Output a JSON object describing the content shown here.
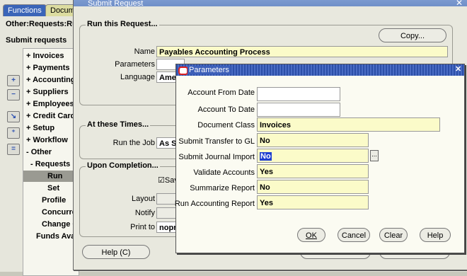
{
  "navigator": {
    "tabs": [
      "Functions",
      "Documents"
    ],
    "title": "Other:Requests:Run",
    "subtitle": "Submit requests",
    "items": [
      {
        "prefix": "+",
        "label": "Invoices"
      },
      {
        "prefix": "+",
        "label": "Payments"
      },
      {
        "prefix": "+",
        "label": "Accounting"
      },
      {
        "prefix": "+",
        "label": "Suppliers"
      },
      {
        "prefix": "+",
        "label": "Employees"
      },
      {
        "prefix": "+",
        "label": "Credit Card"
      },
      {
        "prefix": "+",
        "label": "Setup"
      },
      {
        "prefix": "+",
        "label": "Workflow"
      },
      {
        "prefix": "-",
        "label": "Other"
      },
      {
        "prefix": "-",
        "label": "Requests"
      },
      {
        "prefix": "",
        "label": "Run"
      },
      {
        "prefix": "",
        "label": "Set"
      },
      {
        "prefix": "",
        "label": "Profile"
      },
      {
        "prefix": "",
        "label": "Concurrent"
      },
      {
        "prefix": "",
        "label": "Change C"
      },
      {
        "prefix": "",
        "label": "Funds Available"
      }
    ]
  },
  "submit_request": {
    "title": "Submit Request",
    "run_group": "Run this Request...",
    "copy_button": "Copy...",
    "name_label": "Name",
    "name_value": "Payables Accounting Process",
    "parameters_label": "Parameters",
    "language_label": "Language",
    "language_value": "Ame",
    "times_group": "At these Times...",
    "run_job_label": "Run the Job",
    "run_job_value": "As So",
    "completion_group": "Upon Completion...",
    "save_label": "Sav",
    "layout_label": "Layout",
    "notify_label": "Notify",
    "print_to_label": "Print to",
    "print_to_value": "nopr",
    "help_button": "Help (C)"
  },
  "parameters": {
    "title": "Parameters",
    "fields": [
      {
        "label": "Account From Date",
        "value": ""
      },
      {
        "label": "Account To Date",
        "value": ""
      },
      {
        "label": "Document Class",
        "value": "Invoices"
      },
      {
        "label": "Submit Transfer to GL",
        "value": "No"
      },
      {
        "label": "Submit Journal Import",
        "value": "No"
      },
      {
        "label": "Validate Accounts",
        "value": "Yes"
      },
      {
        "label": "Summarize Report",
        "value": "No"
      },
      {
        "label": "Run Accounting Report",
        "value": "Yes"
      }
    ],
    "buttons": {
      "ok": "OK",
      "cancel": "Cancel",
      "clear": "Clear",
      "help": "Help"
    },
    "lov_button": "..."
  }
}
